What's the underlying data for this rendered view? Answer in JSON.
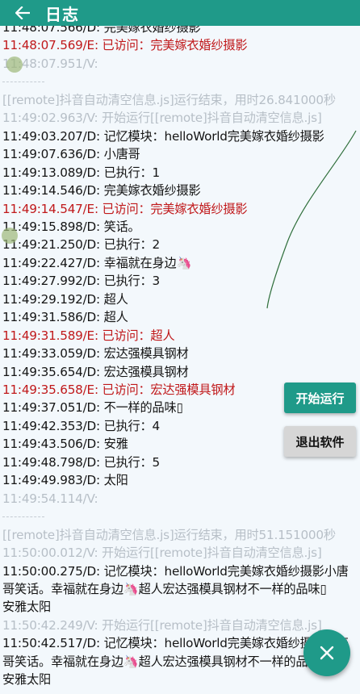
{
  "appbar": {
    "title": "日志",
    "back_icon": "arrow-left-icon"
  },
  "log": {
    "lines": [
      {
        "text": "11:48:07.566/D: 完美嫁衣婚纱摄影",
        "level": "D"
      },
      {
        "text": "11:48:07.569/E: 已访问：完美嫁衣婚纱摄影",
        "level": "E"
      },
      {
        "text": "11:48:07.951/V:",
        "level": "V"
      },
      {
        "text": "",
        "level": "sep"
      },
      {
        "text": "[[remote]抖音自动清空信息.js]运行结束，用时26.841000秒",
        "level": "V"
      },
      {
        "text": "11:49:02.963/V: 开始运行[[remote]抖音自动清空信息.js]",
        "level": "V"
      },
      {
        "text": "11:49:03.207/D: 记忆模块：helloWorld完美嫁衣婚纱摄影",
        "level": "D"
      },
      {
        "text": "11:49:07.636/D: 小唐哥",
        "level": "D"
      },
      {
        "text": "11:49:13.089/D: 已执行：1",
        "level": "D"
      },
      {
        "text": "11:49:14.546/D: 完美嫁衣婚纱摄影",
        "level": "D"
      },
      {
        "text": "11:49:14.547/E: 已访问：完美嫁衣婚纱摄影",
        "level": "E"
      },
      {
        "text": "11:49:15.898/D: 笑话。",
        "level": "D"
      },
      {
        "text": "11:49:21.250/D: 已执行：2",
        "level": "D"
      },
      {
        "text": "11:49:22.427/D: 幸福就在身边🦄",
        "level": "D"
      },
      {
        "text": "11:49:27.992/D: 已执行：3",
        "level": "D"
      },
      {
        "text": "11:49:29.192/D: 超人",
        "level": "D"
      },
      {
        "text": "11:49:31.586/D: 超人",
        "level": "D"
      },
      {
        "text": "11:49:31.589/E: 已访问：超人",
        "level": "E"
      },
      {
        "text": "11:49:33.059/D: 宏达强模具钢材",
        "level": "D"
      },
      {
        "text": "11:49:35.654/D: 宏达强模具钢材",
        "level": "D"
      },
      {
        "text": "11:49:35.658/E: 已访问：宏达强模具钢材",
        "level": "E"
      },
      {
        "text": "11:49:37.051/D: 不一样的品味▯",
        "level": "D"
      },
      {
        "text": "11:49:42.353/D: 已执行：4",
        "level": "D"
      },
      {
        "text": "11:49:43.506/D: 安雅",
        "level": "D"
      },
      {
        "text": "11:49:48.798/D: 已执行：5",
        "level": "D"
      },
      {
        "text": "11:49:49.983/D: 太阳",
        "level": "D"
      },
      {
        "text": "11:49:54.114/V:",
        "level": "V"
      },
      {
        "text": "",
        "level": "sep"
      },
      {
        "text": "[[remote]抖音自动清空信息.js]运行结束，用时51.151000秒",
        "level": "V"
      },
      {
        "text": "11:50:00.012/V: 开始运行[[remote]抖音自动清空信息.js]",
        "level": "V"
      },
      {
        "text": "11:50:00.275/D: 记忆模块：helloWorld完美嫁衣婚纱摄影小唐",
        "level": "D"
      },
      {
        "text": "哥笑话。幸福就在身边🦄超人宏达强模具钢材不一样的品味▯",
        "level": "D"
      },
      {
        "text": "安雅太阳",
        "level": "D"
      },
      {
        "text": "11:50:42.249/V: 开始运行[[remote]抖音自动清空信息.js]",
        "level": "V"
      },
      {
        "text": "11:50:42.517/D: 记忆模块：helloWorld完美嫁衣婚纱摄影小唐",
        "level": "D"
      },
      {
        "text": "哥笑话。幸福就在身边🦄超人宏达强模具钢材不一样的品味▯",
        "level": "D"
      },
      {
        "text": "安雅太阳",
        "level": "D"
      }
    ]
  },
  "buttons": {
    "start_label": "开始运行",
    "exit_label": "退出软件"
  },
  "fab": {
    "icon": "close-icon"
  },
  "colors": {
    "accent": "#1f9a89",
    "debug_text": "#141414",
    "error_text": "#c0181a",
    "verbose_text": "#b7bfc7",
    "background": "#f3f8fc"
  }
}
